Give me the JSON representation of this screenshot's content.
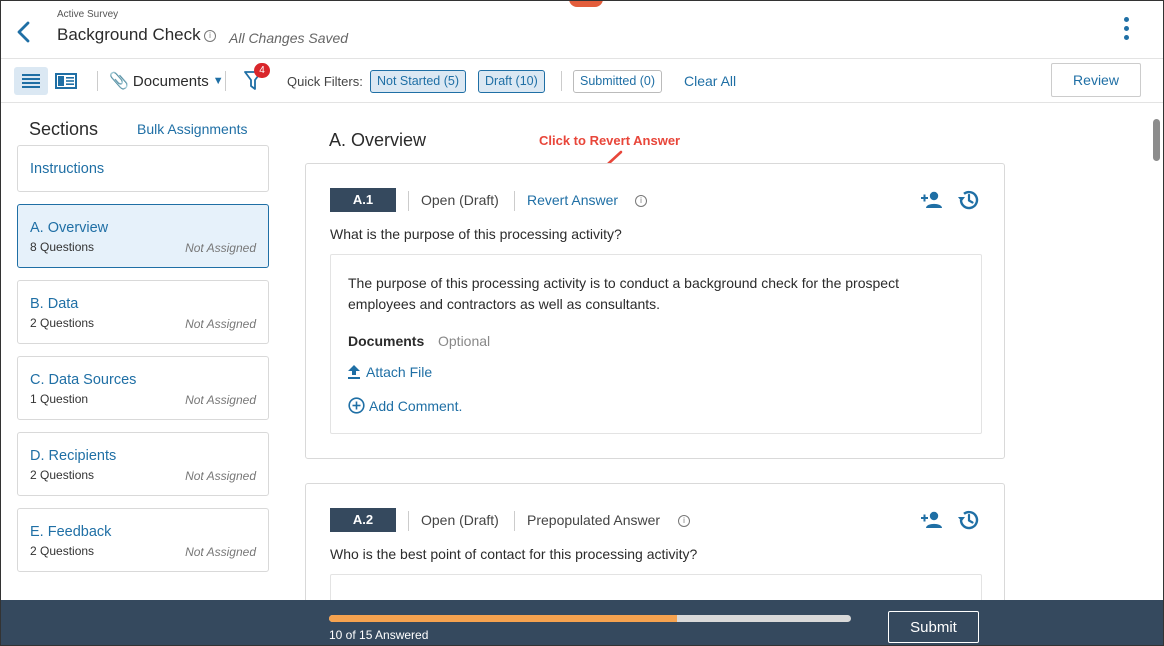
{
  "header": {
    "pre_title": "Active Survey",
    "title": "Background Check",
    "save_status": "All Changes Saved"
  },
  "toolbar": {
    "documents_label": "Documents",
    "filter_badge": "4",
    "quick_filters_label": "Quick Filters:",
    "filters": [
      {
        "label": "Not Started (5)",
        "selected": true
      },
      {
        "label": "Draft (10)",
        "selected": true
      },
      {
        "label": "Submitted (0)",
        "selected": false
      }
    ],
    "clear_all": "Clear All",
    "review": "Review"
  },
  "sidebar": {
    "title": "Sections",
    "bulk_assignments": "Bulk Assignments",
    "instructions": "Instructions",
    "sections": [
      {
        "name": "A. Overview",
        "count": "8 Questions",
        "assignment": "Not Assigned",
        "active": true
      },
      {
        "name": "B. Data",
        "count": "2 Questions",
        "assignment": "Not Assigned",
        "active": false
      },
      {
        "name": "C. Data Sources",
        "count": "1 Question",
        "assignment": "Not Assigned",
        "active": false
      },
      {
        "name": "D. Recipients",
        "count": "2 Questions",
        "assignment": "Not Assigned",
        "active": false
      },
      {
        "name": "E. Feedback",
        "count": "2 Questions",
        "assignment": "Not Assigned",
        "active": false
      }
    ]
  },
  "main": {
    "section_title": "A. Overview",
    "callout": "Click to Revert Answer",
    "questions": [
      {
        "tag": "A.1",
        "status": "Open (Draft)",
        "action": "Revert Answer",
        "question": "What is the purpose of this processing activity?",
        "answer": "The purpose of this processing activity is to conduct a background check for the prospect employees and contractors as well as consultants.",
        "documents_label": "Documents",
        "optional_label": "Optional",
        "attach_file": "Attach File",
        "add_comment": "Add Comment."
      },
      {
        "tag": "A.2",
        "status": "Open (Draft)",
        "action": "Prepopulated Answer",
        "question": "Who is the best point of contact for this processing activity?"
      }
    ]
  },
  "footer": {
    "progress_answered": 10,
    "progress_total": 15,
    "progress_label": "10 of 15 Answered",
    "submit": "Submit"
  },
  "colors": {
    "accent": "#1f6fa5",
    "footer_bg": "#35495e",
    "progress_fill": "#f5a24f",
    "callout": "#e8463a"
  }
}
